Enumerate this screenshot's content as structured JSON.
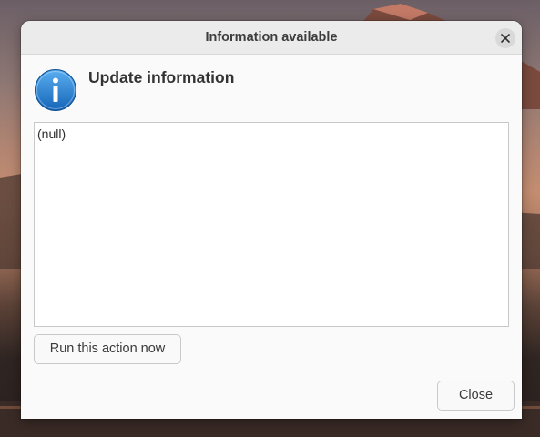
{
  "dialog": {
    "title": "Information available",
    "heading": "Update information",
    "icon": "info-icon",
    "content_text": "(null)",
    "run_button_label": "Run this action now",
    "close_button_label": "Close"
  },
  "titlebar": {
    "close_icon": "close-icon"
  },
  "colors": {
    "dialog_bg": "#fafafa",
    "titlebar_bg": "#ebebeb",
    "icon_blue": "#1c78c9"
  }
}
